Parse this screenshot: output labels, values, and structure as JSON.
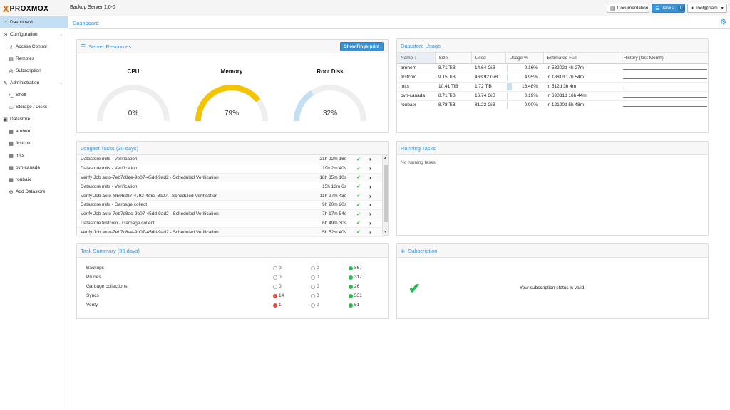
{
  "header": {
    "logo_x": "X",
    "logo_text": "PROXMOX",
    "product": "Backup Server 1.0-0",
    "documentation": "Documentation",
    "tasks_label": "Tasks",
    "tasks_count": "0",
    "user": "root@pam"
  },
  "sidebar": {
    "items": [
      {
        "label": "Dashboard",
        "icon": "dashboard-icon",
        "level": 0
      },
      {
        "label": "Configuration",
        "icon": "gears-icon",
        "level": 0
      },
      {
        "label": "Access Control",
        "icon": "key-icon",
        "level": 1
      },
      {
        "label": "Remotes",
        "icon": "server-icon",
        "level": 1
      },
      {
        "label": "Subscription",
        "icon": "support-icon",
        "level": 1
      },
      {
        "label": "Administration",
        "icon": "wrench-icon",
        "level": 0
      },
      {
        "label": "Shell",
        "icon": "terminal-icon",
        "level": 1
      },
      {
        "label": "Storage / Disks",
        "icon": "hdd-icon",
        "level": 1
      },
      {
        "label": "Datastore",
        "icon": "archive-icon",
        "level": 0
      },
      {
        "label": "arnhem",
        "icon": "database-icon",
        "level": 1
      },
      {
        "label": "firstcolo",
        "icon": "database-icon",
        "level": 1
      },
      {
        "label": "mits",
        "icon": "database-icon",
        "level": 1
      },
      {
        "label": "ovh-canada",
        "icon": "database-icon",
        "level": 1
      },
      {
        "label": "roubaix",
        "icon": "database-icon",
        "level": 1
      },
      {
        "label": "Add Datastore",
        "icon": "plus-circle-icon",
        "level": 1
      }
    ]
  },
  "main": {
    "title": "Dashboard"
  },
  "server_resources": {
    "title": "Server Resources",
    "fingerprint_button": "Show Fingerprint",
    "gauges": [
      {
        "label": "CPU",
        "value": 0,
        "display": "0%",
        "color": "#c2dff3"
      },
      {
        "label": "Memory",
        "value": 79,
        "display": "79%",
        "color": "#f5c400"
      },
      {
        "label": "Root Disk",
        "value": 32,
        "display": "32%",
        "color": "#c2dff3"
      }
    ]
  },
  "datastore_usage": {
    "title": "Datastore Usage",
    "columns": [
      "Name ↑",
      "Size",
      "Used",
      "Usage %",
      "Estimated Full",
      "History (last Month)"
    ],
    "rows": [
      {
        "name": "arnhem",
        "size": "8.71 TiB",
        "used": "14.64 GiB",
        "usage": "0.16%",
        "usage_frac": 0.0016,
        "full": "in 53202d 4h 27m"
      },
      {
        "name": "firstcolo",
        "size": "9.15 TiB",
        "used": "463.92 GiB",
        "usage": "4.95%",
        "usage_frac": 0.0495,
        "full": "in 1881d 17h 54m"
      },
      {
        "name": "mits",
        "size": "10.41 TiB",
        "used": "1.72 TiB",
        "usage": "16.48%",
        "usage_frac": 0.1648,
        "full": "in 512d 3h 4m"
      },
      {
        "name": "ovh-canada",
        "size": "8.71 TiB",
        "used": "16.74 GiB",
        "usage": "0.19%",
        "usage_frac": 0.0019,
        "full": "in 69031d 16h 44m"
      },
      {
        "name": "roubaix",
        "size": "8.78 TiB",
        "used": "81.22 GiB",
        "usage": "0.90%",
        "usage_frac": 0.009,
        "full": "in 12120d 5h 48m"
      }
    ]
  },
  "longest_tasks": {
    "title": "Longest Tasks (30 days)",
    "rows": [
      {
        "name": "Datastore mits - Verification",
        "duration": "21h 22m 16s"
      },
      {
        "name": "Datastore mits - Verification",
        "duration": "19h 2m 40s"
      },
      {
        "name": "Verify Job auto-7eb7c8ae-9b07-45dd-9ad2 - Scheduled Verification",
        "duration": "18h 35m 10s"
      },
      {
        "name": "Datastore mits - Verification",
        "duration": "15h 18m 6s"
      },
      {
        "name": "Verify Job auto-fd59b287-4792-4e83-8a97 - Scheduled Verification",
        "duration": "11h 27m 43s"
      },
      {
        "name": "Datastore mits - Garbage collect",
        "duration": "9h 20m 20s"
      },
      {
        "name": "Verify Job auto-7eb7c8ae-9b07-45dd-9ad2 - Scheduled Verification",
        "duration": "7h 17m 54s"
      },
      {
        "name": "Datastore firstcolo - Garbage collect",
        "duration": "6h 49m 30s"
      },
      {
        "name": "Verify Job auto-7eb7c8ae-9b07-45dd-9ad2 - Scheduled Verification",
        "duration": "5h 52m 40s"
      }
    ]
  },
  "running_tasks": {
    "title": "Running Tasks",
    "empty": "No running tasks"
  },
  "task_summary": {
    "title": "Task Summary (30 days)",
    "rows": [
      {
        "name": "Backups",
        "error": "0",
        "error_status": "gray",
        "warning": "0",
        "ok": "867"
      },
      {
        "name": "Prunes",
        "error": "0",
        "error_status": "gray",
        "warning": "0",
        "ok": "317"
      },
      {
        "name": "Garbage collections",
        "error": "0",
        "error_status": "gray",
        "warning": "0",
        "ok": "26"
      },
      {
        "name": "Syncs",
        "error": "14",
        "error_status": "red",
        "warning": "0",
        "ok": "531"
      },
      {
        "name": "Verify",
        "error": "1",
        "error_status": "red",
        "warning": "0",
        "ok": "51"
      }
    ]
  },
  "subscription": {
    "title": "Subscription",
    "status": "Your subscription status is valid."
  }
}
